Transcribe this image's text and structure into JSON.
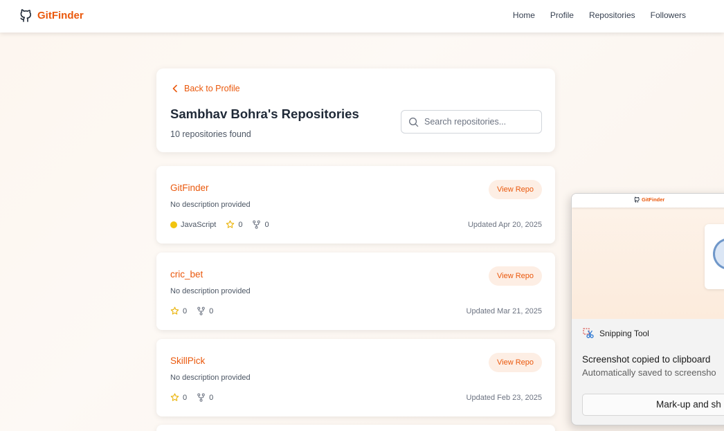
{
  "nav": {
    "brand": "GitFinder",
    "links": [
      "Home",
      "Profile",
      "Repositories",
      "Followers"
    ]
  },
  "header": {
    "back_label": "Back to Profile",
    "title": "Sambhav Bohra's Repositories",
    "count": "10 repositories found",
    "search_placeholder": "Search repositories..."
  },
  "repos": [
    {
      "name": "GitFinder",
      "description": "No description provided",
      "language": "JavaScript",
      "language_color": "#f1c40f",
      "stars": "0",
      "forks": "0",
      "updated": "Updated Apr 20, 2025",
      "button": "View Repo"
    },
    {
      "name": "cric_bet",
      "description": "No description provided",
      "language": null,
      "stars": "0",
      "forks": "0",
      "updated": "Updated Mar 21, 2025",
      "button": "View Repo"
    },
    {
      "name": "SkillPick",
      "description": "No description provided",
      "language": null,
      "stars": "0",
      "forks": "0",
      "updated": "Updated Feb 23, 2025",
      "button": "View Repo"
    }
  ],
  "toast": {
    "thumb_brand": "GitFinder",
    "app_name": "Snipping Tool",
    "title": "Screenshot copied to clipboard",
    "subtitle": "Automatically saved to screensho",
    "button": "Mark-up and sh"
  },
  "colors": {
    "accent": "#ea580c",
    "button_bg": "#fdeee4",
    "star": "#eab308"
  },
  "icons": {
    "brand": "github-icon",
    "back": "chevron-left-icon",
    "search": "search-icon",
    "star": "star-icon",
    "fork": "fork-icon",
    "snip": "snipping-tool-icon"
  }
}
